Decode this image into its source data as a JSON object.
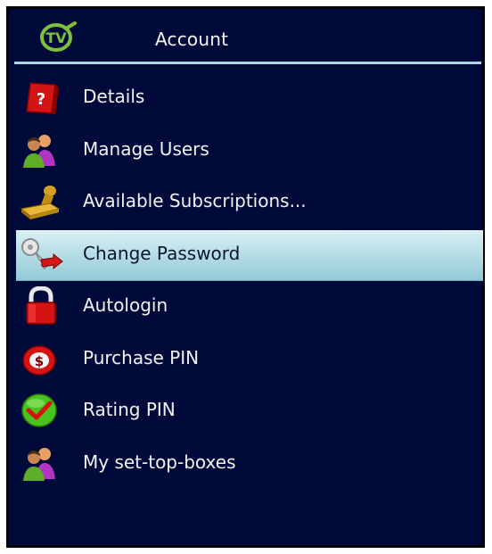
{
  "header": {
    "logo_text": "TV",
    "title": "Account"
  },
  "menu": {
    "items": [
      {
        "label": "Details",
        "icon": "help-book-icon"
      },
      {
        "label": "Manage Users",
        "icon": "users-icon"
      },
      {
        "label": "Available Subscriptions...",
        "icon": "stamp-icon"
      },
      {
        "label": "Change Password",
        "icon": "key-icon",
        "selected": true
      },
      {
        "label": "Autologin",
        "icon": "lock-icon"
      },
      {
        "label": "Purchase PIN",
        "icon": "dollar-icon"
      },
      {
        "label": "Rating PIN",
        "icon": "check-icon"
      },
      {
        "label": "My set-top-boxes",
        "icon": "users-icon"
      }
    ]
  },
  "colors": {
    "background": "#000a3a",
    "selection": "#b8dfe8",
    "divider": "#a9d6df",
    "logo": "#7dc13a"
  }
}
